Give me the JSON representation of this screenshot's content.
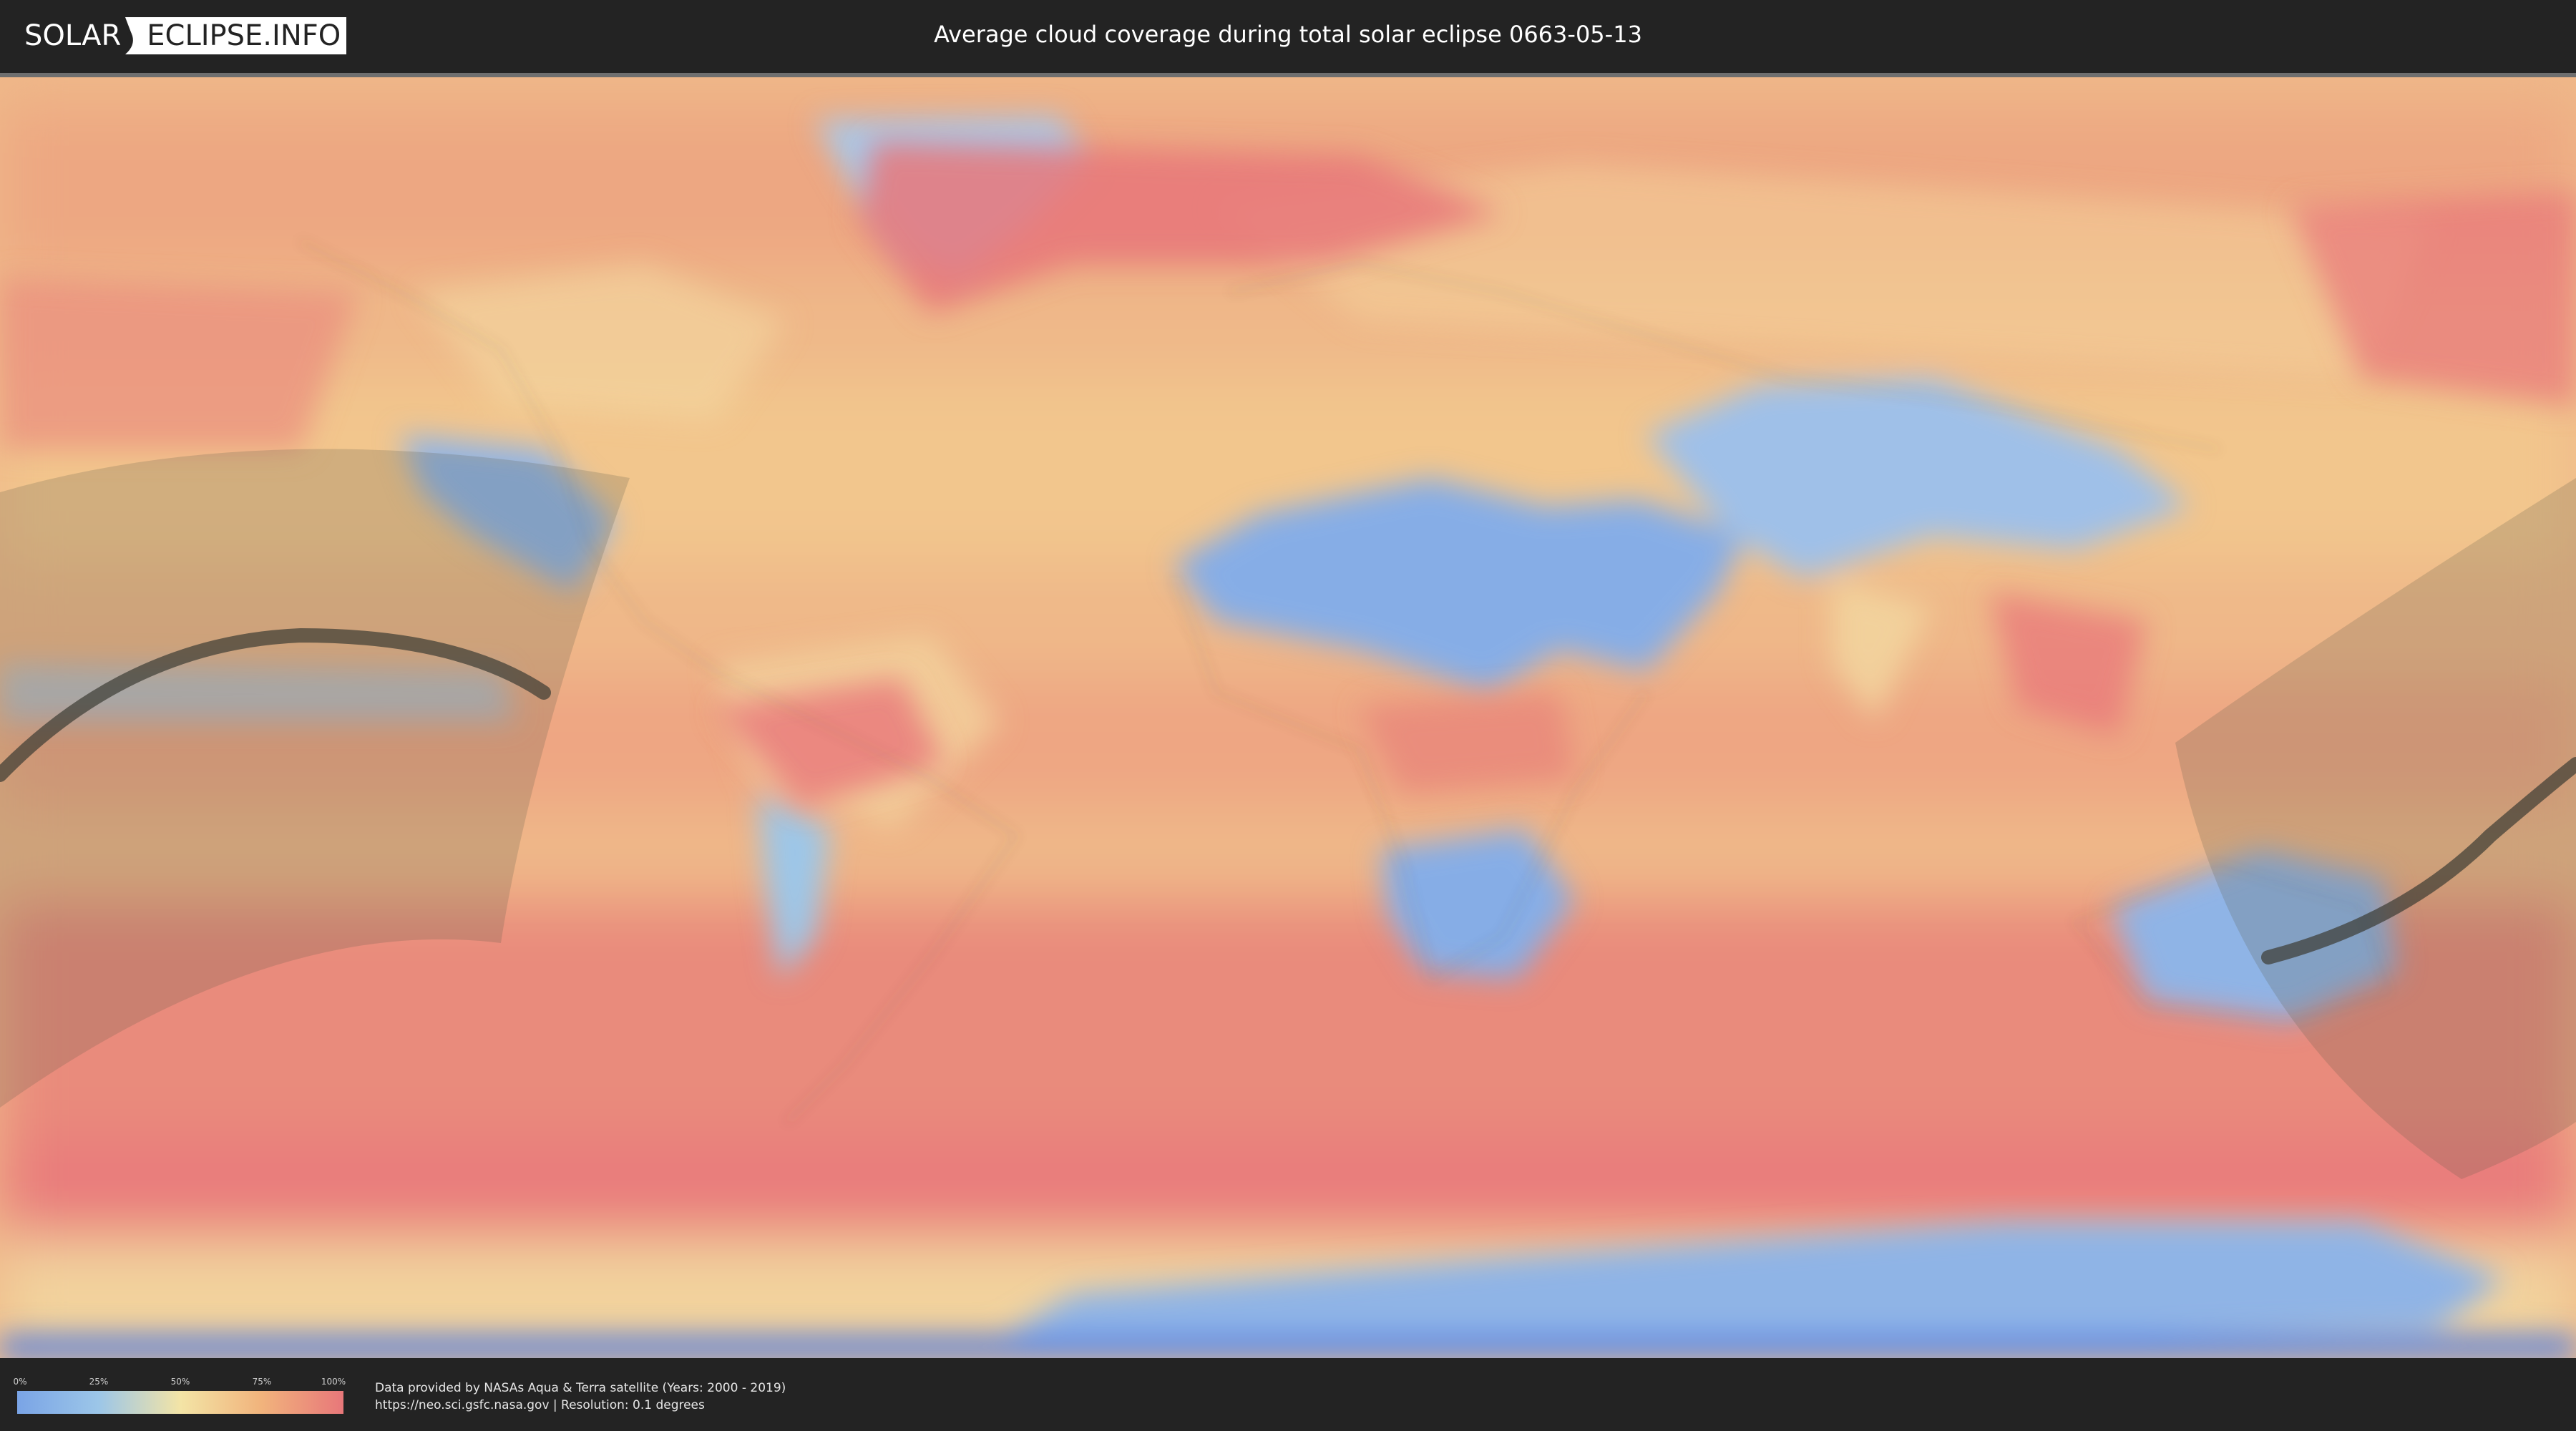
{
  "header": {
    "logo_left": "SOLAR",
    "logo_right": "ECLIPSE.INFO",
    "title": "Average cloud coverage during total solar eclipse 0663-05-13"
  },
  "legend": {
    "ticks": [
      "0%",
      "25%",
      "50%",
      "75%",
      "100%"
    ],
    "colors": [
      "#7aa4e6",
      "#9cc6e8",
      "#f3e4a6",
      "#f1b37c",
      "#e8777a"
    ]
  },
  "footer": {
    "credit_line1": "Data provided by NASAs Aqua & Terra satellite (Years: 2000 - 2019)",
    "credit_line2": "https://neo.sci.gsfc.nasa.gov | Resolution: 0.1 degrees"
  },
  "map": {
    "colors": {
      "ocean_base": "#efb889",
      "high_cloud": "#e8777a",
      "low_cloud": "#8fb4e6",
      "mid_cloud": "#f3d7a0",
      "shadow": "#5a5a4a",
      "path": "#3b3a33"
    }
  }
}
